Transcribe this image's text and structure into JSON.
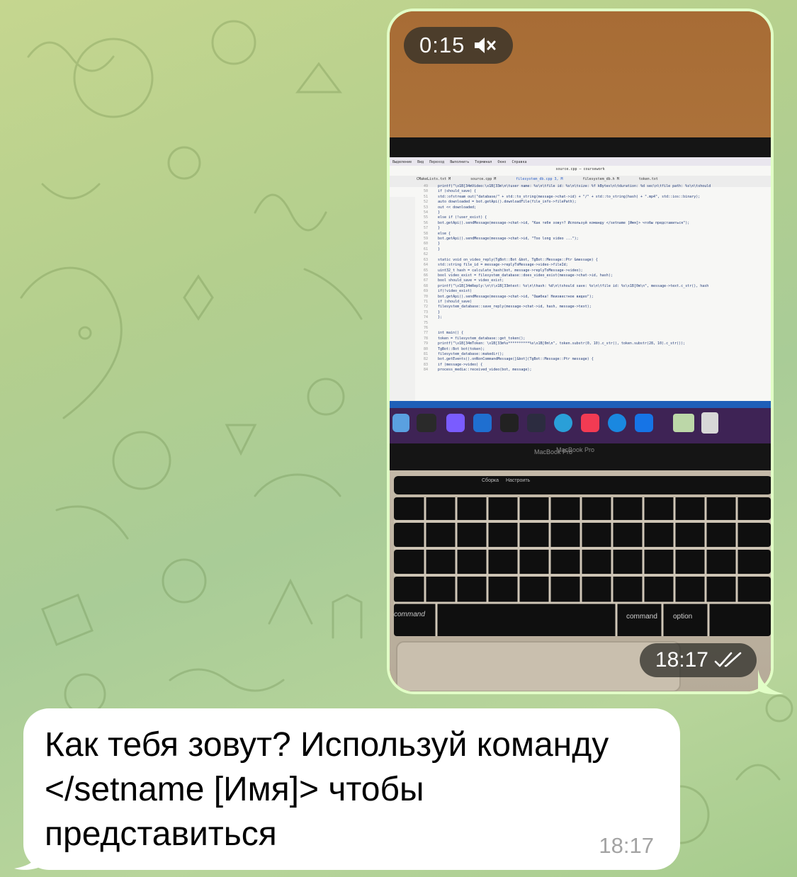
{
  "chat": {
    "video_message": {
      "duration": "0:15",
      "sound_state_icon": "speaker-muted-icon",
      "time": "18:17",
      "read_status_icon": "double-check-icon",
      "screen_code_lines": [
        "printf(\"\\x1B[34mVideo:\\x1B[33m\\n\\tuser name: %s\\n\\tfile id: %s\\n\\tsize: %f kBytes\\n\\tduration: %d sec\\n\\tfile path: %s\\n\\tshould",
        "if (should_save) {",
        "std::ofstream out(\"database/\" + std::to_string(message->chat->id) + \"/\" + std::to_string(hash) + \".mp4\", std::ios::binary);",
        "auto downloaded = bot.getApi().downloadFile(file_info->filePath);",
        "out << downloaded;",
        "}",
        "else if (!user_exist) {",
        "bot.getApi().sendMessage(message->chat->id, \"Как тебя зовут? Используй команду </setname [Имя]> чтобы представиться\");",
        "}",
        "else {",
        "bot.getApi().sendMessage(message->chat->id, \"Too long video ...\");",
        "}",
        "}",
        "",
        "static void on_video_reply(TgBot::Bot &bot, TgBot::Message::Ptr &message) {",
        "std::string file_id = message->replyToMessage->video->fileId;",
        "uint32_t hash = calculate_hash(bot, message->replyToMessage->video);",
        "bool video_exist = filesystem_database::does_video_exist(message->chat->id, hash);",
        "bool should_save = video_exist;",
        "printf(\"\\x1B[34mReply:\\n\\t\\x1B[33mtext: %s\\n\\thash: %d\\n\\tshould save: %s\\n\\tfile id: %s\\x1B[0m\\n\", message->text.c_str(), hash",
        "if(!video_exist)",
        "bot.getApi().sendMessage(message->chat->id, \"Ошибка! Неизвестное видео\");",
        "if (should_save)",
        "filesystem_database::save_reply(message->chat->id, hash, message->text);",
        "}",
        "};",
        "",
        "",
        "int main() {",
        "token = filesystem_database::get_token();",
        "printf(\"\\x1B[34mToken: \\x1B[33m%s**********%s\\x1B[0m\\n\", token.substr(0, 10).c_str(), token.substr(28, 10).c_str());",
        "TgBot::Bot bot(token);",
        "filesystem_database::makedir();",
        "bot.getEvents().onNonCommandMessage([&bot](TgBot::Message::Ptr message) {",
        "if (message->video) {",
        "process_media::received_video(bot, message);"
      ],
      "screen_line_numbers_start": 49,
      "screen_menu": [
        "Выделение",
        "Вид",
        "Переход",
        "Выполнить",
        "Терминал",
        "Окно",
        "Справка"
      ],
      "screen_title": "source.cpp — coursework",
      "screen_tabs": [
        "CMakeLists.txt M",
        "source.cpp M",
        "filesystem_db.cpp 3, M",
        "filesystem_db.h M",
        "token.txt"
      ],
      "laptop_label": "MacBook Pro",
      "touchbar_items": [
        "Сборка",
        "Настроить"
      ],
      "key_labels": {
        "command_left": "command",
        "command_right": "command",
        "option_right": "option"
      }
    },
    "incoming_message": {
      "text": "Как тебя зовут? Используй команду </setname [Имя]> чтобы представиться",
      "time": "18:17"
    }
  },
  "colors": {
    "outgoing_bubble": "#e1fec6",
    "incoming_bubble": "#ffffff",
    "overlay_pill": "#2d2d28"
  }
}
